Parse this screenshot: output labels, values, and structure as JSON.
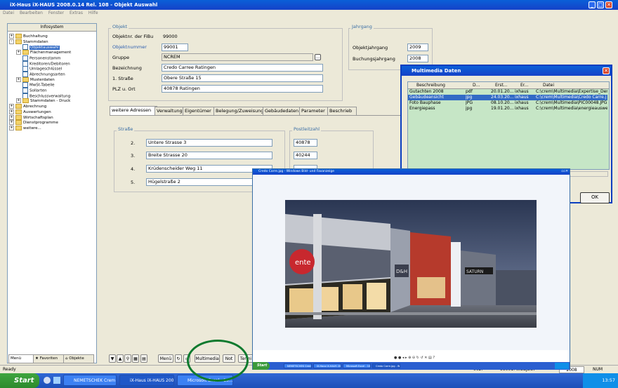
{
  "app": {
    "title": "iX-Haus iX-HAUS 2008.0.14 Rel. 108 - Objekt Auswahl",
    "menu": [
      "Datei",
      "Bearbeiten",
      "Fenster",
      "Extras",
      "Hilfe"
    ]
  },
  "sidebar": {
    "header": "Infosystem",
    "tree": [
      {
        "label": "Buchhaltung",
        "type": "folder",
        "expander": "+"
      },
      {
        "label": "Stammdaten",
        "type": "folder",
        "expander": "-"
      },
      {
        "label": "Objektauswahl",
        "type": "doc",
        "selected": true
      },
      {
        "label": "Flächenmanagement",
        "type": "folder",
        "expander": "+"
      },
      {
        "label": "Personenstamm",
        "type": "doc"
      },
      {
        "label": "Kreditoren/Debitoren",
        "type": "doc"
      },
      {
        "label": "Umlageschlüssel",
        "type": "doc"
      },
      {
        "label": "Abrechnungsarten",
        "type": "doc"
      },
      {
        "label": "Musterdaten",
        "type": "folder",
        "expander": "+"
      },
      {
        "label": "MwSt-Tabelle",
        "type": "doc"
      },
      {
        "label": "Sollarten",
        "type": "doc"
      },
      {
        "label": "Beschlussverwaltung",
        "type": "doc"
      },
      {
        "label": "Stammdaten - Druck",
        "type": "folder",
        "expander": "+"
      },
      {
        "label": "Abrechnung",
        "type": "folder",
        "expander": "+"
      },
      {
        "label": "Auswertungen",
        "type": "folder",
        "expander": "+"
      },
      {
        "label": "Wirtschaftsplan",
        "type": "folder",
        "expander": "+"
      },
      {
        "label": "Dienstprogramme",
        "type": "folder",
        "expander": "+"
      },
      {
        "label": "weitere...",
        "type": "folder",
        "expander": "+"
      }
    ],
    "bottom_tabs": [
      "Menü",
      "Favoriten",
      "Objekte"
    ]
  },
  "objekt": {
    "group_title": "Objekt",
    "fibu_label": "Objektnr. der FiBu",
    "fibu_value": "99000",
    "objektnummer_label": "Objektnummer",
    "objektnummer_value": "99001",
    "gruppe_label": "Gruppe",
    "gruppe_value": "NCREM",
    "bezeichnung_label": "Bezeichnung",
    "bezeichnung_value": "Credo Carree Ratingen",
    "strasse_label": "1. Straße",
    "strasse_value": "Obere Straße 15",
    "plz_label": "PLZ u. Ort",
    "plz_value": "40878 Ratingen"
  },
  "jahrgang": {
    "group_title": "Jahrgang",
    "objekt_label": "Objektjahrgang",
    "objekt_value": "2009",
    "buchung_label": "Buchungsjahrgang",
    "buchung_value": "2008"
  },
  "tabs": [
    "weitere Adressen",
    "Verwaltung",
    "Eigentümer",
    "Belegung/Zuweisung",
    "Gebäudedaten",
    "Parameter",
    "Beschrieb"
  ],
  "adressen": {
    "strasse_title": "Straße",
    "plz_title": "Postleitzahl",
    "rows": [
      {
        "num": "2.",
        "street": "Untere Strasse 3",
        "plz": "40878"
      },
      {
        "num": "3.",
        "street": "Breite Strasse 20",
        "plz": "40244"
      },
      {
        "num": "4.",
        "street": "Krüdenscheider Weg 11",
        "plz": ""
      },
      {
        "num": "5.",
        "street": "Hügelstraße 2",
        "plz": ""
      }
    ]
  },
  "bottombar": {
    "menu_button": "Menü",
    "multimedia_button": "Multimedia",
    "notiz_button": "Not",
    "termin_button": "Termi"
  },
  "multimedia": {
    "title": "Multimedia Daten",
    "columns": [
      "Beschreibung",
      "D...",
      "Erst...",
      "Er...",
      "Datei"
    ],
    "rows": [
      {
        "desc": "Gutachten 2008",
        "type": "pdf",
        "date": "20.01.20...",
        "user": "ixhaus",
        "file": "C:\\crem\\Multimedia\\Expertise_Der"
      },
      {
        "desc": "Gebäudeansicht",
        "type": "jpg",
        "date": "24.03.20...",
        "user": "ixhaus",
        "file": "C:\\crem\\Multimedia\\Credo Carre.j",
        "selected": true
      },
      {
        "desc": "Foto Bauphase",
        "type": "JPG",
        "date": "08.10.20...",
        "user": "ixhaus",
        "file": "C:\\crem\\Multimedia\\PIC00048.JPG"
      },
      {
        "desc": "Energiepass",
        "type": "jpg",
        "date": "19.01.20...",
        "user": "ixhaus",
        "file": "C:\\crem\\Multimedia\\energieauswe"
      }
    ],
    "ok_label": "OK"
  },
  "viewer": {
    "title": "Credo Carre.jpg - Windows Bild- und Faxanzeige",
    "toolbar": "● ● ◂ ▸ ⊕ ⊖ ↻ ↺ ✕ ▤ ?",
    "taskbar_start": "Start",
    "taskbar_items": [
      "NEMETSCHEK Crem S...",
      "iX-Haus iX-HAUS 200...",
      "Microsoft Excel - 10...",
      "Credo Carre.jpg - Wi..."
    ],
    "photo_sign_left": "ente",
    "photo_sign_mid": "D&H",
    "photo_sign_right": "SATURN"
  },
  "status": {
    "left": "Ready",
    "code": "002:",
    "object": "99001: IxOBJECT",
    "year": "2008",
    "mode": "NUM"
  },
  "taskbar": {
    "start": "Start",
    "items": [
      "NEMETSCHEK Crem S...",
      "iX-Haus iX-HAUS 200...",
      "Microsoft Excel - 10..."
    ],
    "clock": "13:57"
  },
  "colors": {
    "accent": "#316ac5",
    "title_bar": "#0a5fd8",
    "highlight_circle": "#0d7a2e",
    "table_bg": "#c6e6c6"
  }
}
